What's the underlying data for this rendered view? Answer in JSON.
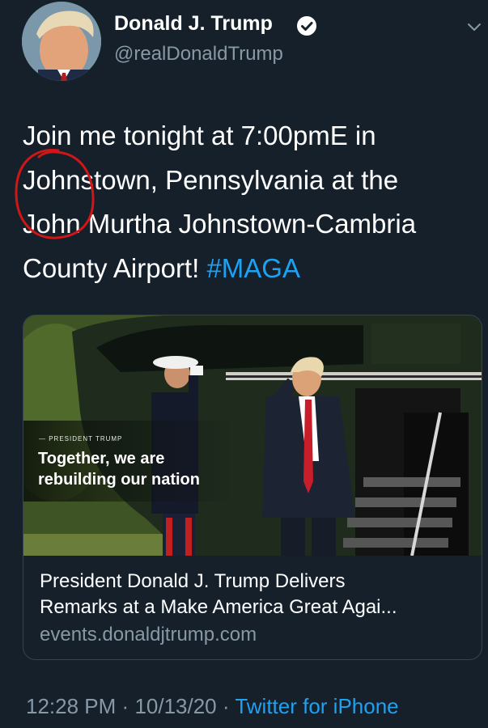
{
  "author": {
    "name": "Donald J. Trump",
    "handle": "@realDonaldTrump",
    "verified": true,
    "avatar_icon": "profile-photo"
  },
  "tweet": {
    "lines": [
      "Join me tonight at 7:00pmE in",
      "Johnstown, Pennsylvania at the",
      "John Murtha Johnstown-Cambria"
    ],
    "last_line_text": "County Airport! ",
    "hashtag": "#MAGA",
    "annotation": "red hand-drawn circle around \"John\""
  },
  "card": {
    "image_kicker": "— PRESIDENT TRUMP",
    "image_headline_line1": "Together, we are",
    "image_headline_line2": "rebuilding our nation",
    "title_line1": "President Donald J. Trump Delivers",
    "title_line2": "Remarks at a Make America Great Agai...",
    "domain": "events.donaldjtrump.com"
  },
  "meta": {
    "time": "12:28 PM",
    "date": "10/13/20",
    "separator": "·",
    "source": "Twitter for iPhone"
  },
  "colors": {
    "background": "#15202b",
    "text": "#ffffff",
    "secondary_text": "#8899a6",
    "accent": "#1da1f2",
    "annotation_red": "#d01616",
    "card_border": "#38444d"
  }
}
